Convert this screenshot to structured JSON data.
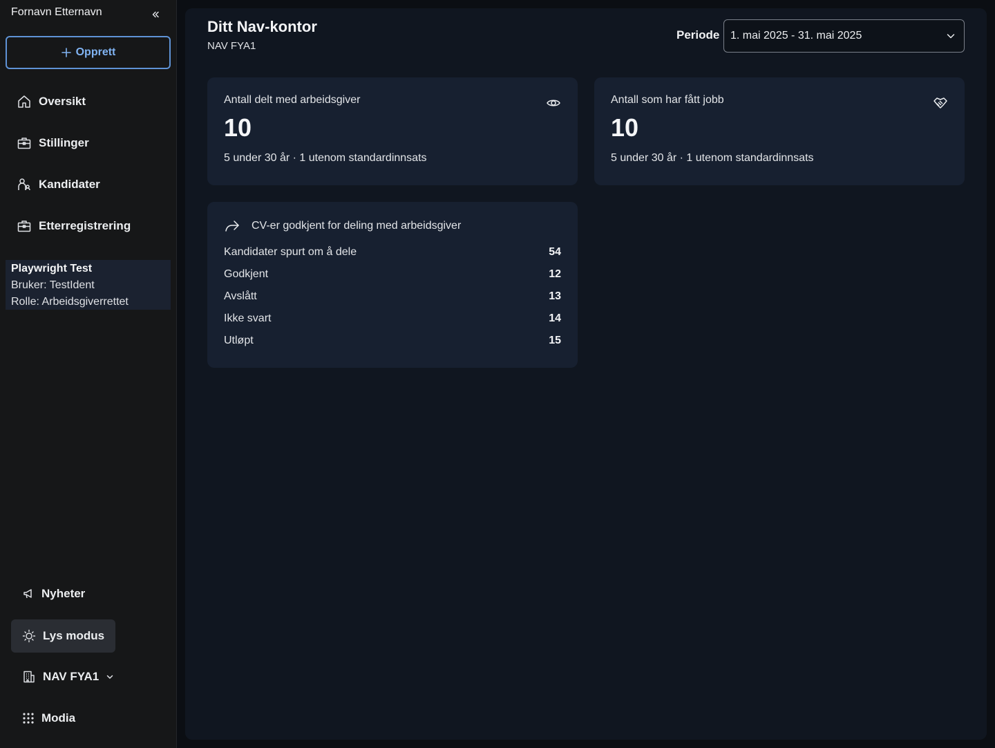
{
  "sidebar": {
    "user_name": "Fornavn Etternavn",
    "create_label": "Opprett",
    "items": [
      {
        "label": "Oversikt",
        "icon": "home-icon"
      },
      {
        "label": "Stillinger",
        "icon": "briefcase-icon"
      },
      {
        "label": "Kandidater",
        "icon": "person-icon"
      },
      {
        "label": "Etterregistrering",
        "icon": "briefcase-icon"
      }
    ],
    "info": {
      "title": "Playwright Test",
      "user": "Bruker: TestIdent",
      "role": "Rolle: Arbeidsgiverrettet"
    },
    "bottom": {
      "news": "Nyheter",
      "theme": "Lys modus",
      "office": "NAV FYA1",
      "modia": "Modia"
    }
  },
  "header": {
    "title": "Ditt Nav-kontor",
    "subtitle": "NAV FYA1",
    "period_label": "Periode",
    "period_value": "1. mai 2025 - 31. mai 2025"
  },
  "cards": {
    "shared": {
      "label": "Antall delt med arbeidsgiver",
      "value": "10",
      "sub": "5 under 30 år · 1 utenom standardinnsats",
      "icon": "eye-icon"
    },
    "hired": {
      "label": "Antall som har fått jobb",
      "value": "10",
      "sub": "5 under 30 år · 1 utenom standardinnsats",
      "icon": "handshake-icon"
    }
  },
  "cv": {
    "title": "CV-er godkjent for deling med arbeidsgiver",
    "icon": "share-arrow-icon",
    "rows": [
      {
        "label": "Kandidater spurt om å dele",
        "value": "54"
      },
      {
        "label": "Godkjent",
        "value": "12"
      },
      {
        "label": "Avslått",
        "value": "13"
      },
      {
        "label": "Ikke svart",
        "value": "14"
      },
      {
        "label": "Utløpt",
        "value": "15"
      }
    ]
  },
  "colors": {
    "accent": "#80b3f2",
    "sidebar_bg": "#161718",
    "main_bg": "#101620",
    "card_bg": "#172030"
  }
}
